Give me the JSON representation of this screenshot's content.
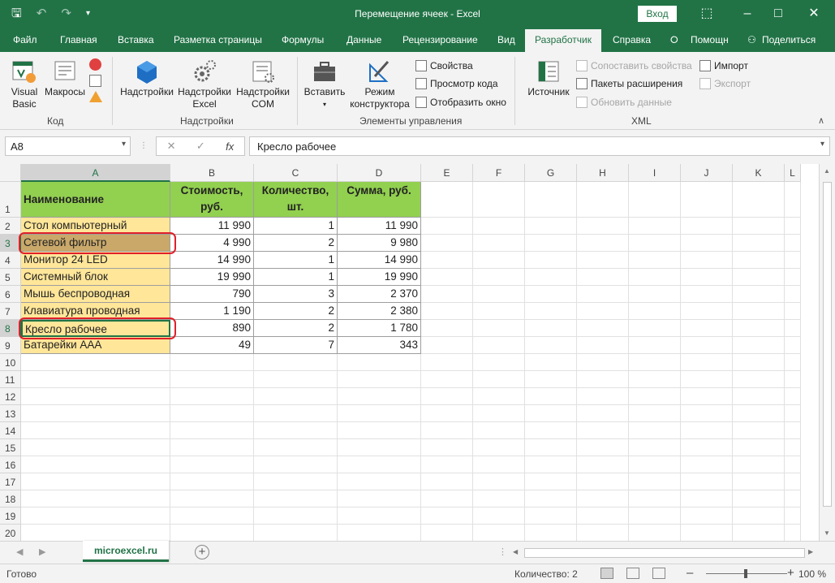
{
  "window": {
    "title": "Перемещение ячеек  -  Excel",
    "signin": "Вход"
  },
  "tabs": [
    "Файл",
    "Главная",
    "Вставка",
    "Разметка страницы",
    "Формулы",
    "Данные",
    "Рецензирование",
    "Вид",
    "Разработчик",
    "Справка",
    "Помощн",
    "Поделиться"
  ],
  "ribbon": {
    "code": {
      "visual_basic": "Visual Basic",
      "macros": "Макросы",
      "label": "Код"
    },
    "addins": {
      "addins": "Надстройки",
      "excel_addins": "Надстройки Excel",
      "com_addins": "Надстройки COM",
      "label": "Надстройки"
    },
    "controls": {
      "insert": "Вставить",
      "design_mode": "Режим конструктора",
      "properties": "Свойства",
      "view_code": "Просмотр кода",
      "run_dialog": "Отобразить окно",
      "label": "Элементы управления"
    },
    "xml": {
      "source": "Источник",
      "map_properties": "Сопоставить свойства",
      "expansion_packs": "Пакеты расширения",
      "refresh_data": "Обновить данные",
      "import": "Импорт",
      "export": "Экспорт",
      "label": "XML"
    }
  },
  "formula_bar": {
    "name_box": "A8",
    "fx": "fx",
    "value": "Кресло рабочее"
  },
  "columns": [
    "A",
    "B",
    "C",
    "D",
    "E",
    "F",
    "G",
    "H",
    "I",
    "J",
    "K",
    "L"
  ],
  "rows": [
    "1",
    "2",
    "3",
    "4",
    "5",
    "6",
    "7",
    "8",
    "9",
    "10",
    "11",
    "12",
    "13",
    "14",
    "15",
    "16",
    "17",
    "18",
    "19",
    "20"
  ],
  "table": {
    "headers": [
      "Наименование",
      "Стоимость, руб.",
      "Количество, шт.",
      "Сумма, руб."
    ],
    "rows": [
      [
        "Стол компьютерный",
        "11 990",
        "1",
        "11 990"
      ],
      [
        "Сетевой фильтр",
        "4 990",
        "2",
        "9 980"
      ],
      [
        "Монитор 24 LED",
        "14 990",
        "1",
        "14 990"
      ],
      [
        "Системный блок",
        "19 990",
        "1",
        "19 990"
      ],
      [
        "Мышь беспроводная",
        "790",
        "3",
        "2 370"
      ],
      [
        "Клавиатура проводная",
        "1 190",
        "2",
        "2 380"
      ],
      [
        "Кресло рабочее",
        "890",
        "2",
        "1 780"
      ],
      [
        "Батарейки AAA",
        "49",
        "7",
        "343"
      ]
    ]
  },
  "sheet_tab": "microexcel.ru",
  "status": {
    "ready": "Готово",
    "count": "Количество: 2",
    "zoom": "100 %"
  },
  "colors": {
    "excel_green": "#217346",
    "header_fill": "#92d050",
    "name_fill": "#ffe699",
    "highlight": "#e0202a"
  }
}
